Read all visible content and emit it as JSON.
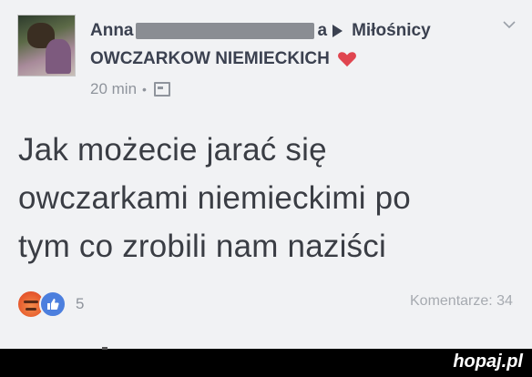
{
  "post": {
    "author_first": "Anna",
    "author_last_fragment": "a",
    "group_line1": "Miłośnicy",
    "group_line2": "OWCZARKOW NIEMIECKICH",
    "time": "20 min",
    "text_lines": [
      "Jak możecie jarać się",
      "owczarkami niemieckimi po",
      "tym co zrobili nam naziści"
    ],
    "reaction_count": "5",
    "comments": "Komentarze: 34"
  },
  "icons": {
    "heart": "heart-icon",
    "privacy": "globe-icon",
    "menu": "chevron-down-icon",
    "reaction_angry": "angry-icon",
    "reaction_like": "like-icon"
  },
  "colors": {
    "background": "#f1f2f4",
    "text": "#3a3d44",
    "heart": "#e0454f",
    "like_blue": "#4c7fde",
    "angry_orange": "#e85d2f"
  },
  "watermark": "hopaj.pl"
}
